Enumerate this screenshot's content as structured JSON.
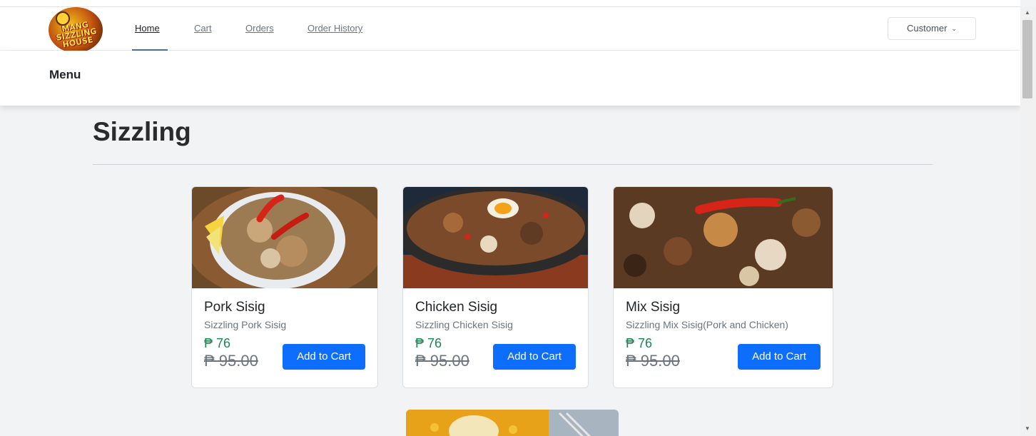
{
  "brand": {
    "logo_text": "Mang Sizzling House"
  },
  "nav": {
    "links": [
      "Home",
      "Cart",
      "Orders",
      "Order History"
    ],
    "active": "Home",
    "user_menu_label": "Customer"
  },
  "subheader": {
    "title": "Menu"
  },
  "section": {
    "title": "Sizzling"
  },
  "products": [
    {
      "name": "Pork Sisig",
      "description": "Sizzling Pork Sisig",
      "price": "₱ 76",
      "old_price": "₱ 95.00",
      "button": "Add to Cart"
    },
    {
      "name": "Chicken Sisig",
      "description": "Sizzling Chicken Sisig",
      "price": "₱ 76",
      "old_price": "₱ 95.00",
      "button": "Add to Cart"
    },
    {
      "name": "Mix Sisig",
      "description": "Sizzling Mix Sisig(Pork and Chicken)",
      "price": "₱ 76",
      "old_price": "₱ 95.00",
      "button": "Add to Cart"
    }
  ],
  "colors": {
    "primary": "#0d6efd",
    "price_green": "#198754",
    "background": "#f1f3f4"
  }
}
